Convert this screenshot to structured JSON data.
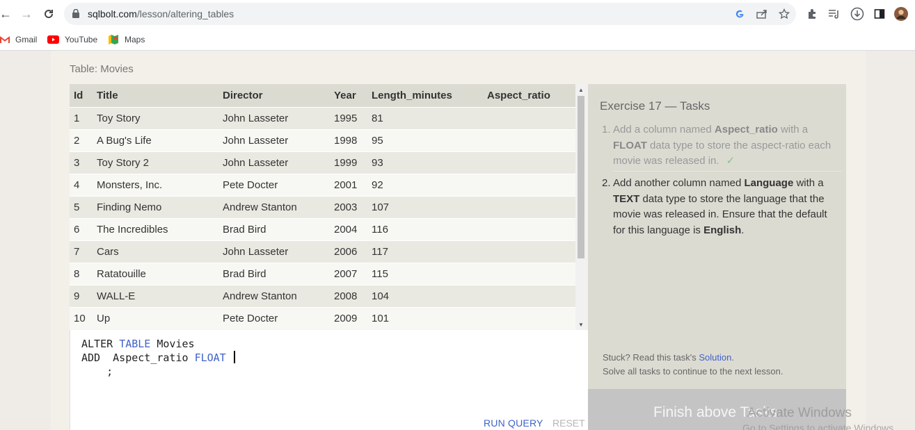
{
  "browser": {
    "url_host": "sqlbolt.com",
    "url_path": "/lesson/altering_tables",
    "bookmarks": [
      "Gmail",
      "YouTube",
      "Maps"
    ]
  },
  "table": {
    "caption": "Table: Movies",
    "columns": [
      "Id",
      "Title",
      "Director",
      "Year",
      "Length_minutes",
      "Aspect_ratio"
    ],
    "rows": [
      [
        "1",
        "Toy Story",
        "John Lasseter",
        "1995",
        "81",
        ""
      ],
      [
        "2",
        "A Bug's Life",
        "John Lasseter",
        "1998",
        "95",
        ""
      ],
      [
        "3",
        "Toy Story 2",
        "John Lasseter",
        "1999",
        "93",
        ""
      ],
      [
        "4",
        "Monsters, Inc.",
        "Pete Docter",
        "2001",
        "92",
        ""
      ],
      [
        "5",
        "Finding Nemo",
        "Andrew Stanton",
        "2003",
        "107",
        ""
      ],
      [
        "6",
        "The Incredibles",
        "Brad Bird",
        "2004",
        "116",
        ""
      ],
      [
        "7",
        "Cars",
        "John Lasseter",
        "2006",
        "117",
        ""
      ],
      [
        "8",
        "Ratatouille",
        "Brad Bird",
        "2007",
        "115",
        ""
      ],
      [
        "9",
        "WALL-E",
        "Andrew Stanton",
        "2008",
        "104",
        ""
      ],
      [
        "10",
        "Up",
        "Pete Docter",
        "2009",
        "101",
        ""
      ]
    ]
  },
  "editor": {
    "line1_a": "ALTER ",
    "line1_kw": "TABLE",
    "line1_b": " Movies",
    "line2_a": "ADD  Aspect_ratio ",
    "line2_kw": "FLOAT",
    "line2_b": " ",
    "line3": "    ;",
    "run_label": "RUN QUERY",
    "reset_label": "RESET"
  },
  "tasks": {
    "title": "Exercise 17 — Tasks",
    "task1_num": "1.",
    "task1_a": "Add a column named ",
    "task1_b1": "Aspect_ratio",
    "task1_c": " with a ",
    "task1_b2": "FLOAT",
    "task1_d": " data type to store the aspect-ratio each movie was released in.",
    "task1_check": "✓",
    "task2_num": "2.",
    "task2_a": "Add another column named ",
    "task2_b1": "Language",
    "task2_c": " with a ",
    "task2_b2": "TEXT",
    "task2_d": " data type to store the language that the movie was released in. Ensure that the default for this language is ",
    "task2_b3": "English",
    "task2_e": ".",
    "help_prefix": "Stuck? Read this task's ",
    "help_link": "Solution",
    "help_suffix": ".",
    "help2": "Solve all tasks to continue to the next lesson.",
    "finish_label": "Finish above Tasks"
  },
  "watermark": {
    "line1": "Activate Windows",
    "line2": "Go to Settings to activate Windows."
  }
}
